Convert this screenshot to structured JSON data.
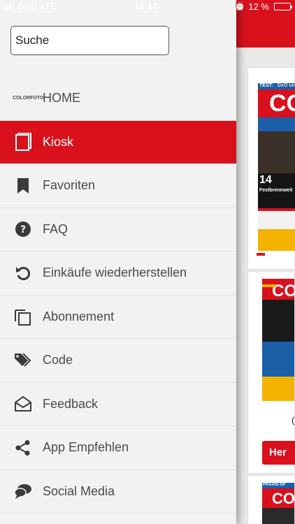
{
  "status_bar": {
    "carrier": "Blau",
    "network": "LTE",
    "time": "10:13",
    "battery_percent": "12 %",
    "battery_level": 0.12
  },
  "search": {
    "value": "Suche"
  },
  "menu": [
    {
      "label": "HOME",
      "logo": "COLORFOTO",
      "icon": "colorfoto-logo"
    },
    {
      "label": "Kiosk",
      "icon": "magazine-icon",
      "active": true
    },
    {
      "label": "Favoriten",
      "icon": "bookmark-icon"
    },
    {
      "label": "FAQ",
      "icon": "question-icon"
    },
    {
      "label": "Einkäufe wiederherstellen",
      "icon": "restore-icon"
    },
    {
      "label": "Abonnement",
      "icon": "copy-icon"
    },
    {
      "label": "Code",
      "icon": "tag-icon"
    },
    {
      "label": "Feedback",
      "icon": "envelope-open-icon"
    },
    {
      "label": "App Empfehlen",
      "icon": "share-icon"
    },
    {
      "label": "Social Media",
      "icon": "chat-icon"
    }
  ],
  "background": {
    "card1": {
      "test_label": "TEST:",
      "test_sub": "DxO un",
      "logo_big": "CO",
      "issue_badge": "14",
      "badge_text": "Festbrennweit"
    },
    "card2": {
      "logo_big": "CO",
      "price_partial": "(",
      "button_partial": "Her"
    },
    "card3": {
      "top_label": "PRAXIS-SP",
      "logo_big": "CO"
    }
  },
  "colors": {
    "accent": "#d8111d",
    "text": "#4a4a4a",
    "drawer_bg": "#f2f2f2"
  }
}
